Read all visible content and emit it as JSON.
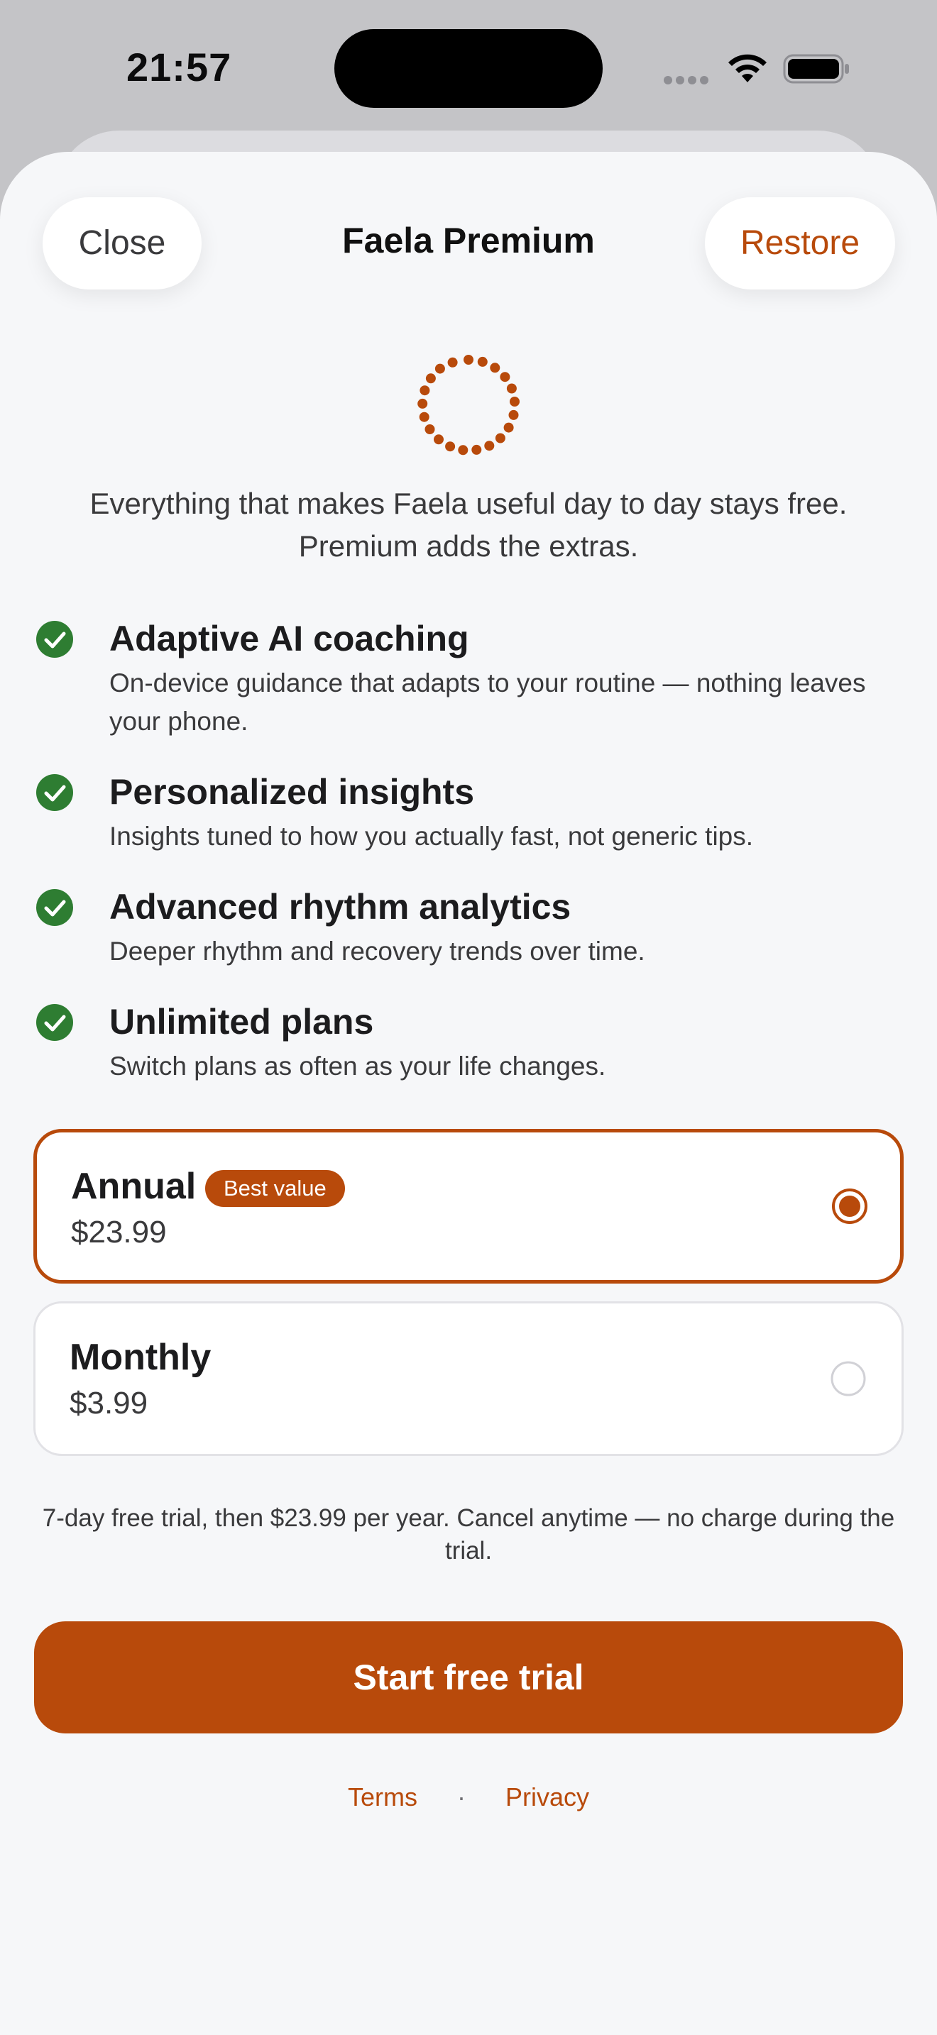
{
  "status_bar": {
    "time": "21:57",
    "icons": [
      "signal-icon",
      "wifi-icon",
      "battery-icon"
    ]
  },
  "header": {
    "close_label": "Close",
    "title": "Faela Premium",
    "restore_label": "Restore"
  },
  "hero": {
    "icon": "dotted-circle-icon",
    "intro_line1": "Everything that makes Faela useful day to day stays free.",
    "intro_line2": "Premium adds the extras."
  },
  "features": [
    {
      "icon": "check-circle-icon",
      "title": "Adaptive AI coaching",
      "description": "On-device guidance that adapts to your routine — nothing leaves your phone."
    },
    {
      "icon": "check-circle-icon",
      "title": "Personalized insights",
      "description": "Insights tuned to how you actually fast, not generic tips."
    },
    {
      "icon": "check-circle-icon",
      "title": "Advanced rhythm analytics",
      "description": "Deeper rhythm and recovery trends over time."
    },
    {
      "icon": "check-circle-icon",
      "title": "Unlimited plans",
      "description": "Switch plans as often as your life changes."
    }
  ],
  "plans": [
    {
      "name": "Annual",
      "badge": "Best value",
      "price": "$23.99",
      "selected": true
    },
    {
      "name": "Monthly",
      "price": "$3.99",
      "selected": false
    }
  ],
  "trial_note": "7-day free trial, then $23.99 per year. Cancel anytime — no charge during the trial.",
  "cta_label": "Start free trial",
  "footer": {
    "terms_label": "Terms",
    "separator": "·",
    "privacy_label": "Privacy"
  },
  "colors": {
    "accent": "#b84a0b",
    "check_green": "#2e7d32",
    "sheet_background": "#f6f7f9",
    "backdrop": "#c4c4c7"
  }
}
